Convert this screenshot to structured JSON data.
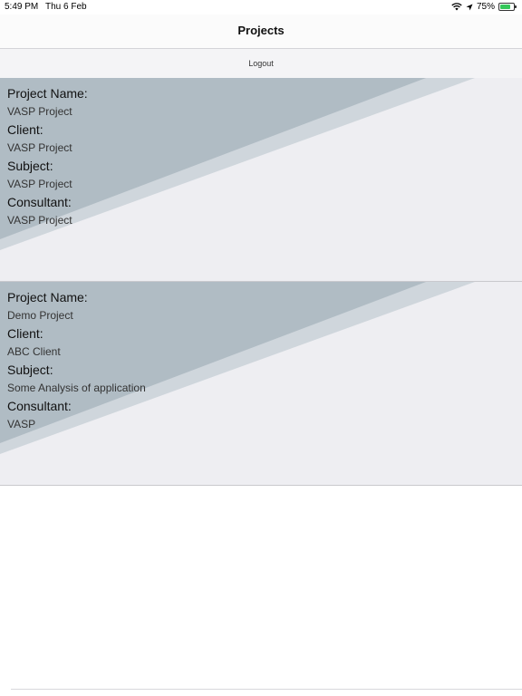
{
  "status_bar": {
    "time": "5:49 PM",
    "date": "Thu 6 Feb",
    "battery": "75%",
    "battery_level": 0.75,
    "icons": [
      "wifi-icon",
      "location-arrow-icon",
      "battery-icon"
    ]
  },
  "nav": {
    "title": "Projects"
  },
  "toolbar": {
    "logout_label": "Logout"
  },
  "labels": {
    "project_name": "Project Name:",
    "client": "Client:",
    "subject": "Subject:",
    "consultant": "Consultant:"
  },
  "projects": [
    {
      "project_name": "VASP Project",
      "client": "VASP Project",
      "subject": "VASP Project",
      "consultant": "VASP Project"
    },
    {
      "project_name": "Demo Project",
      "client": "ABC Client",
      "subject": "Some Analysis of application",
      "consultant": "VASP"
    }
  ],
  "colors": {
    "card_background": "#eeeef2",
    "stripe_dark": "#b0bcc4",
    "stripe_light": "#cfd6dc",
    "battery_green": "#34c759"
  }
}
